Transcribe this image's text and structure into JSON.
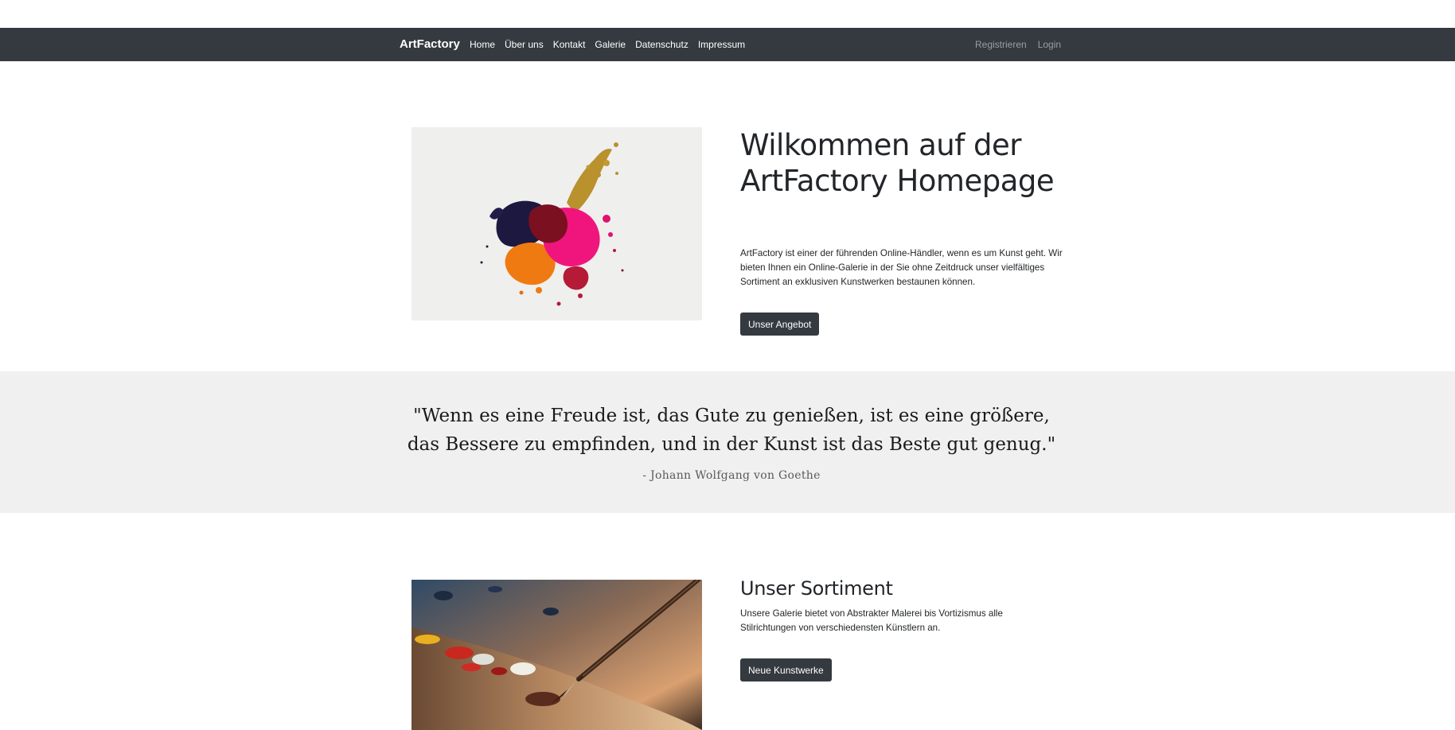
{
  "navbar": {
    "brand": "ArtFactory",
    "links": [
      "Home",
      "Über uns",
      "Kontakt",
      "Galerie",
      "Datenschutz",
      "Impressum"
    ],
    "right_links": [
      "Registrieren",
      "Login"
    ],
    "background_color": "#343a40"
  },
  "hero": {
    "title": "Wilkommen auf der ArtFactory Homepage",
    "text": "ArtFactory ist einer der führenden Online-Händler, wenn es um Kunst geht. Wir bieten Ihnen ein Online-Galerie in der Sie ohne Zeitdruck unser vielfältiges Sortiment an exklusiven Kunstwerken bestaunen können.",
    "button_label": "Unser Angebot"
  },
  "quote": {
    "text": "\"Wenn es eine Freude ist, das Gute zu genießen, ist es eine größere, das Bessere zu empfinden, und in der Kunst ist das Beste gut genug.\"",
    "author": "- Johann Wolfgang von Goethe",
    "background_color": "#f0f0f0"
  },
  "sortiment": {
    "title": "Unser Sortiment",
    "text": "Unsere Galerie bietet von Abstrakter Malerei bis Vortizismus alle Stilrichtungen von verschiedensten Künstlern an.",
    "button_label": "Neue Kunstwerke"
  }
}
